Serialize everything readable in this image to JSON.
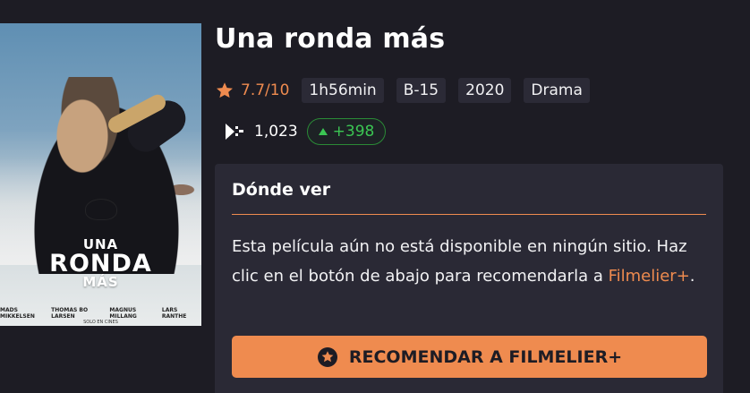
{
  "movie": {
    "title": "Una ronda más",
    "rating": "7.7/10",
    "tags": [
      "1h56min",
      "B-15",
      "2020",
      "Drama"
    ]
  },
  "stats": {
    "views": "1,023",
    "delta": "+398"
  },
  "poster": {
    "title_line1": "UNA",
    "title_line2": "RONDA",
    "title_line3": "MÁS",
    "credits": [
      "MADS MIKKELSEN",
      "THOMAS BO LARSEN",
      "MAGNUS MILLANG",
      "LARS RANTHE"
    ],
    "footer": "SOLO EN CINES"
  },
  "where_to_watch": {
    "heading": "Dónde ver",
    "text": "Esta película aún no está disponible en ningún sitio. Haz clic en el botón de abajo para recomendarla a ",
    "link": "Filmelier+",
    "text_end": ".",
    "button_label": "RECOMENDAR A FILMELIER+"
  },
  "colors": {
    "accent": "#ef8b4f",
    "background": "#1d1c24",
    "panel": "#2a2935",
    "positive": "#3bc653"
  },
  "icons": {
    "rating": "star-icon",
    "views": "views-icon",
    "delta": "arrow-up-icon",
    "button": "star-circle-icon"
  }
}
